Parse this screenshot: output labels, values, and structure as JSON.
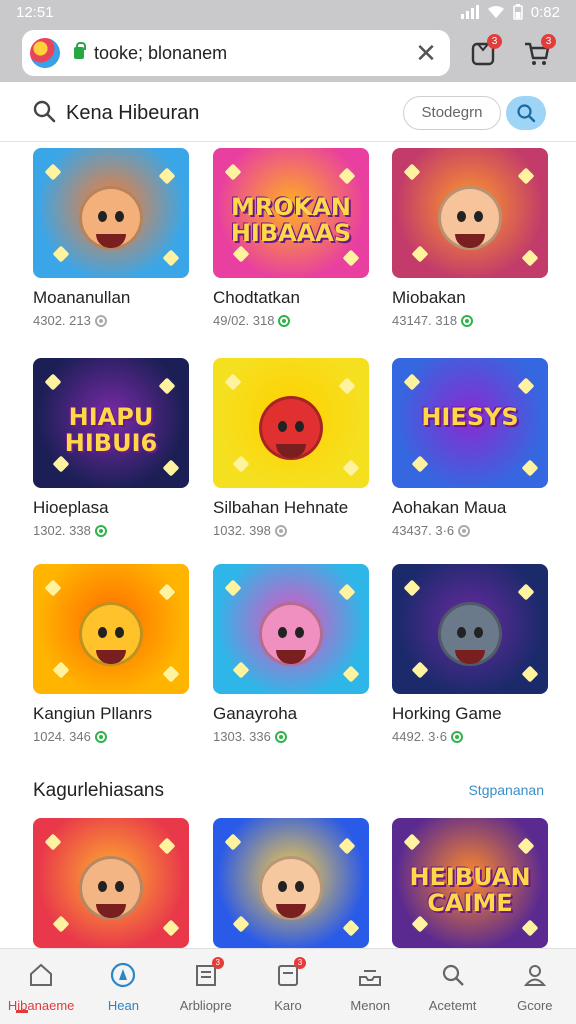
{
  "status": {
    "time": "12:51",
    "battery": "0:82"
  },
  "browser": {
    "url": "tooke; blonanem",
    "header_badges": [
      "3",
      "3"
    ]
  },
  "search": {
    "query": "Kena Hibeuran",
    "chip_label": "Stodegrn"
  },
  "games": [
    {
      "name": "Moananullan",
      "meta": "4302. 213",
      "verified": false,
      "colors": [
        "#3aa6e8",
        "#ff7a2a"
      ],
      "face": "#f3b07a",
      "art_text": ""
    },
    {
      "name": "Chodtatkan",
      "meta": "49/02. 318",
      "verified": true,
      "colors": [
        "#e83fa0",
        "#ffb020"
      ],
      "face": "",
      "art_text": "MROKAN HIBAAAS"
    },
    {
      "name": "Miobakan",
      "meta": "43147. 318",
      "verified": true,
      "colors": [
        "#c23b6a",
        "#ff9b2a"
      ],
      "face": "#f6c39a",
      "art_text": ""
    },
    {
      "name": "Hioeplasa",
      "meta": "1302. 338",
      "verified": true,
      "colors": [
        "#1b1f55",
        "#7a2aa8"
      ],
      "face": "",
      "art_text": "HIAPU HIBUI6"
    },
    {
      "name": "Silbahan Hehnate",
      "meta": "1032. 398",
      "verified": false,
      "colors": [
        "#f5e020",
        "#ffd000"
      ],
      "face": "#e03030",
      "art_text": ""
    },
    {
      "name": "Aohakan Maua",
      "meta": "43437. 3·6",
      "verified": false,
      "colors": [
        "#3568e0",
        "#8a2ad0"
      ],
      "face": "",
      "art_text": "HIESYS"
    },
    {
      "name": "Kangiun Pllanrs",
      "meta": "1024. 346",
      "verified": true,
      "colors": [
        "#ffb400",
        "#ff6a00"
      ],
      "face": "#ffc22a",
      "art_text": ""
    },
    {
      "name": "Ganayroha",
      "meta": "1303. 336",
      "verified": true,
      "colors": [
        "#2fb6e8",
        "#e84fc0"
      ],
      "face": "#f090c0",
      "art_text": ""
    },
    {
      "name": "Horking Game",
      "meta": "4492. 3·6",
      "verified": true,
      "colors": [
        "#1a2a6a",
        "#6a2aa0"
      ],
      "face": "#6a7a8a",
      "art_text": ""
    },
    {
      "name": "",
      "meta": "",
      "verified": false,
      "colors": [
        "#e8384a",
        "#ffb030"
      ],
      "face": "#f4b585",
      "art_text": ""
    },
    {
      "name": "",
      "meta": "",
      "verified": false,
      "colors": [
        "#2a5ae8",
        "#ffd040"
      ],
      "face": "#f6c8a0",
      "art_text": ""
    },
    {
      "name": "",
      "meta": "",
      "verified": false,
      "colors": [
        "#5a2a90",
        "#ff8a2a"
      ],
      "face": "",
      "art_text": "HEIBUAN CAIME"
    }
  ],
  "section": {
    "title": "Kagurlehiasans",
    "link": "Stgpananan"
  },
  "nav": [
    {
      "label": "Hibanaeme",
      "icon": "home-icon",
      "badge": ""
    },
    {
      "label": "Hean",
      "icon": "compass-icon",
      "badge": ""
    },
    {
      "label": "Arbliopre",
      "icon": "library-icon",
      "badge": "3"
    },
    {
      "label": "Karo",
      "icon": "card-icon",
      "badge": "3"
    },
    {
      "label": "Menon",
      "icon": "inbox-icon",
      "badge": ""
    },
    {
      "label": "Acetemt",
      "icon": "search-icon",
      "badge": ""
    },
    {
      "label": "Gcore",
      "icon": "profile-icon",
      "badge": ""
    }
  ],
  "colors": {
    "accent_red": "#e03b3b",
    "accent_blue": "#2a86c7",
    "verified_green": "#2fb34a"
  }
}
